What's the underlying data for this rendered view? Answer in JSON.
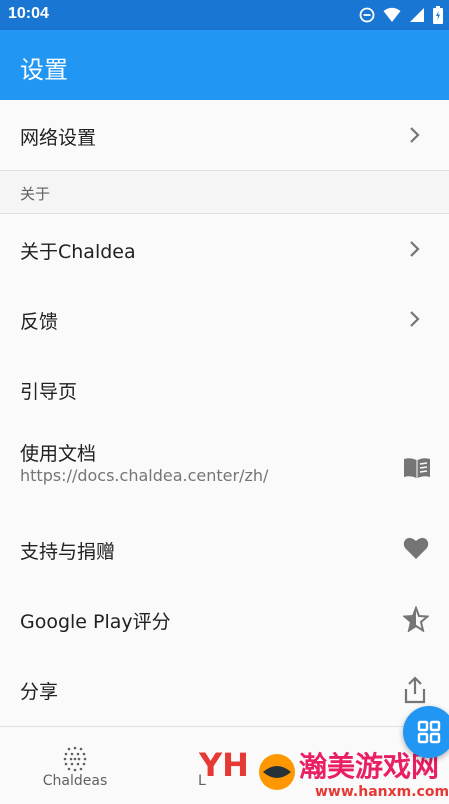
{
  "status_bar": {
    "time": "10:04"
  },
  "app_bar": {
    "title": "设置"
  },
  "rows_top": [
    {
      "label": "网络设置",
      "icon": "chevron-right-icon"
    }
  ],
  "section": {
    "label": "关于"
  },
  "rows": [
    {
      "label": "关于Chaldea",
      "icon": "chevron-right-icon"
    },
    {
      "label": "反馈",
      "icon": "chevron-right-icon"
    },
    {
      "label": "引导页"
    },
    {
      "label": "使用文档",
      "subtitle": "https://docs.chaldea.center/zh/",
      "icon": "book-icon"
    },
    {
      "label": "支持与捐赠",
      "icon": "heart-icon"
    },
    {
      "label": "Google Play评分",
      "icon": "star-half-icon"
    },
    {
      "label": "分享",
      "icon": "share-icon"
    }
  ],
  "bottom_nav": [
    {
      "label": "Chaldeas",
      "icon": "chaldeas-icon"
    },
    {
      "label": "L",
      "icon": "gallery-icon"
    },
    {
      "label": "",
      "icon": "settings-icon"
    }
  ],
  "fab": {
    "icon": "grid-icon"
  },
  "watermark": {
    "text": "www.hanxm.com",
    "brand": "YH 瀚美游戏网"
  },
  "colors": {
    "primary": "#2196f3",
    "status": "#1976d2",
    "icon_gray": "#757575"
  }
}
